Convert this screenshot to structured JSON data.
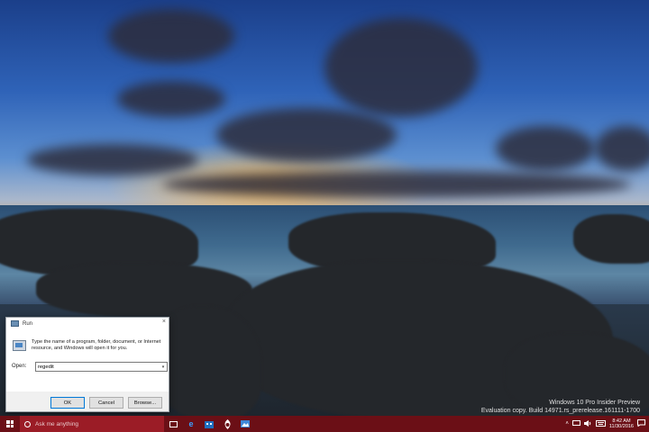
{
  "watermark": {
    "line1": "Windows 10 Pro Insider Preview",
    "line2": "Evaluation copy. Build 14971.rs_prerelease.161111-1700"
  },
  "run_dialog": {
    "title": "Run",
    "close_glyph": "×",
    "description": "Type the name of a program, folder, document, or Internet resource, and Windows will open it for you.",
    "open_label": "Open:",
    "open_value": "regedit",
    "ok_label": "OK",
    "cancel_label": "Cancel",
    "browse_label": "Browse..."
  },
  "taskbar": {
    "search_placeholder": "Ask me anything",
    "time": "8:42 AM",
    "date": "11/30/2016",
    "pinned_icons": [
      "task-view-icon",
      "edge-icon",
      "store-icon",
      "app-icon",
      "photo-app-icon"
    ],
    "tray_icons": [
      "chevron-up-icon",
      "network-icon",
      "volume-icon",
      "keyboard-icon",
      "notification-icon"
    ]
  }
}
